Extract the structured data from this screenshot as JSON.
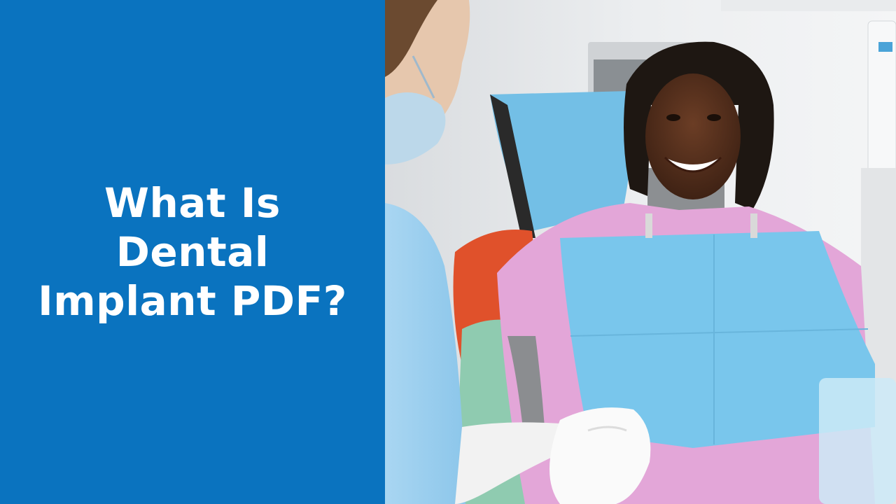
{
  "title": {
    "line1": "What Is",
    "line2": "Dental",
    "line3": "Implant PDF?"
  },
  "colors": {
    "panel_background": "#0a73bf",
    "title_text": "#ffffff"
  },
  "photo": {
    "subject": "dental-patient-photo"
  }
}
